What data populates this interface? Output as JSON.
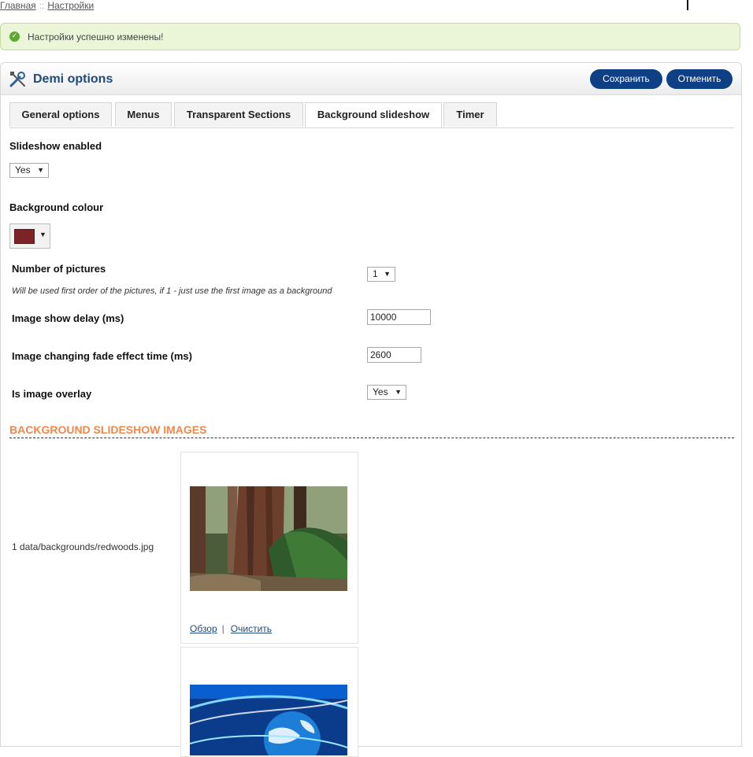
{
  "breadcrumb": {
    "home": "Главная",
    "separator": "::",
    "current": "Настройки"
  },
  "alert": {
    "message": "Настройки успешно изменены!",
    "icon": "check-circle-icon",
    "color": "#eaf6d7"
  },
  "panel": {
    "title": "Demi options",
    "icon": "tools-icon",
    "save_label": "Сохранить",
    "cancel_label": "Отменить",
    "accent": "#0f3f85"
  },
  "tabs": [
    {
      "label": "General options"
    },
    {
      "label": "Menus"
    },
    {
      "label": "Transparent Sections"
    },
    {
      "label": "Background slideshow"
    },
    {
      "label": "Timer"
    }
  ],
  "active_tab": "Background slideshow",
  "form": {
    "slideshow_enabled": {
      "label": "Slideshow enabled",
      "value": "Yes"
    },
    "background_colour": {
      "label": "Background colour",
      "value": "#7b2326"
    },
    "number_of_pictures": {
      "label": "Number of pictures",
      "value": "1",
      "hint": "Will be used first order of the pictures, if 1 - just use the first image as a background"
    },
    "image_show_delay": {
      "label": "Image show delay (ms)",
      "value": "10000"
    },
    "fade_time": {
      "label": "Image changing fade effect time (ms)",
      "value": "2600"
    },
    "image_overlay": {
      "label": "Is image overlay",
      "value": "Yes"
    }
  },
  "images_section": {
    "title": "BACKGROUND SLIDESHOW IMAGES",
    "title_color": "#f0874b",
    "items": [
      {
        "path": "1 data/backgrounds/redwoods.jpg",
        "browse": "Обзор",
        "separator": "|",
        "clear": "Очистить"
      }
    ]
  }
}
